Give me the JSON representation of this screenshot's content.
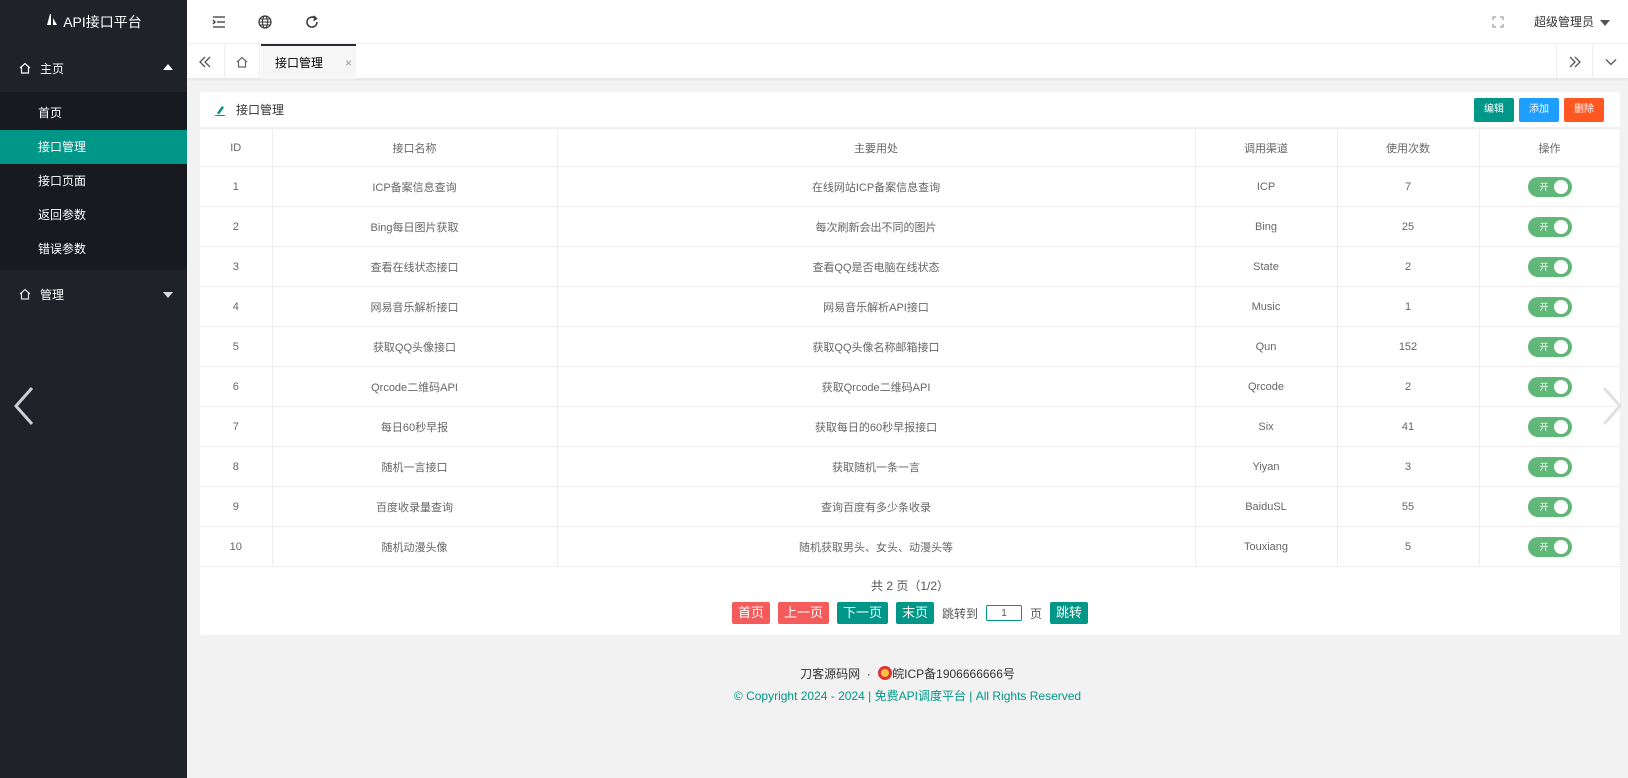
{
  "app": {
    "title": "API接口平台"
  },
  "sidebar": {
    "groups": [
      {
        "label": "主页",
        "items": [
          "首页",
          "接口管理",
          "接口页面",
          "返回参数",
          "错误参数"
        ]
      },
      {
        "label": "管理"
      }
    ],
    "active_item": "接口管理"
  },
  "header": {
    "user": "超级管理员"
  },
  "tabs": {
    "active": "接口管理",
    "close": "×"
  },
  "card": {
    "title": "接口管理",
    "buttons": {
      "edit": "编辑",
      "add": "添加",
      "delete": "删除"
    }
  },
  "table": {
    "columns": [
      "ID",
      "接口名称",
      "主要用处",
      "调用渠道",
      "使用次数",
      "操作"
    ],
    "rows": [
      [
        "1",
        "ICP备案信息查询",
        "在线网站ICP备案信息查询",
        "ICP",
        "7"
      ],
      [
        "2",
        "Bing每日图片获取",
        "每次刷新会出不同的图片",
        "Bing",
        "25"
      ],
      [
        "3",
        "查看在线状态接口",
        "查看QQ是否电脑在线状态",
        "State",
        "2"
      ],
      [
        "4",
        "网易音乐解析接口",
        "网易音乐解析API接口",
        "Music",
        "1"
      ],
      [
        "5",
        "获取QQ头像接口",
        "获取QQ头像名称邮箱接口",
        "Qun",
        "152"
      ],
      [
        "6",
        "Qrcode二维码API",
        "获取Qrcode二维码API",
        "Qrcode",
        "2"
      ],
      [
        "7",
        "每日60秒早报",
        "获取每日的60秒早报接口",
        "Six",
        "41"
      ],
      [
        "8",
        "随机一言接口",
        "获取随机一条一言",
        "Yiyan",
        "3"
      ],
      [
        "9",
        "百度收录量查询",
        "查询百度有多少条收录",
        "BaiduSL",
        "55"
      ],
      [
        "10",
        "随机动漫头像",
        "随机获取男头、女头、动漫头等",
        "Touxiang",
        "5"
      ]
    ],
    "switch_label": "开"
  },
  "pager": {
    "info": "共 2 页（1/2）",
    "first": "首页",
    "prev": "上一页",
    "next": "下一页",
    "last": "末页",
    "jump_prefix": "跳转到",
    "jump_value": "1",
    "jump_suffix": "页",
    "jump_btn": "跳转"
  },
  "footer": {
    "site": "刀客源码网",
    "dot": "·",
    "icp": "皖ICP备1906666666号",
    "copyright": "© Copyright 2024 - 2024 | 免费API调度平台 | All Rights Reserved"
  },
  "colors": {
    "accent": "#009688",
    "sidebar_bg": "#20222a",
    "add": "#1e9fff",
    "delete": "#ff5722",
    "switch_on": "#5fb878"
  }
}
